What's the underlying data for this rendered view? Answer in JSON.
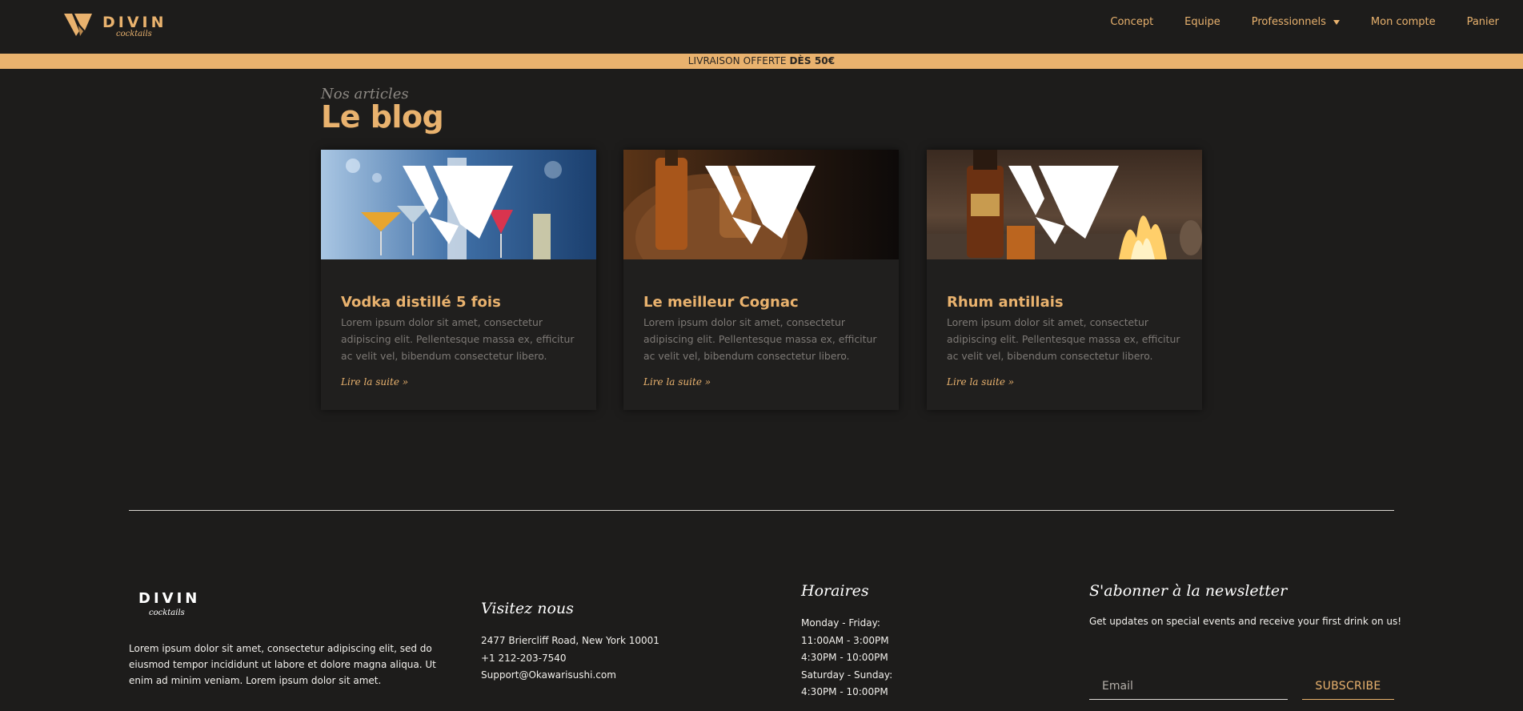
{
  "header": {
    "logo_text": "DIVIN",
    "logo_script": "cocktails",
    "nav": [
      "Concept",
      "Equipe",
      "Professionnels",
      "Mon compte",
      "Panier"
    ]
  },
  "promo": {
    "text": "LIVRAISON OFFERTE ",
    "bold": "DÈS 50€"
  },
  "blog": {
    "subtitle": "Nos articles",
    "title": "Le blog",
    "posts": [
      {
        "title": "Vodka distillé 5 fois",
        "excerpt": "Lorem ipsum dolor sit amet, consectetur adipiscing elit. Pellentesque massa ex, efficitur ac velit vel, bibendum consectetur libero.",
        "link": "Lire la suite »",
        "image": "vodka-cocktails-image"
      },
      {
        "title": "Le meilleur Cognac",
        "excerpt": "Lorem ipsum dolor sit amet, consectetur adipiscing elit. Pellentesque massa ex, efficitur ac velit vel, bibendum consectetur libero.",
        "link": "Lire la suite »",
        "image": "cognac-barrel-image"
      },
      {
        "title": "Rhum antillais",
        "excerpt": "Lorem ipsum dolor sit amet, consectetur adipiscing elit. Pellentesque massa ex, efficitur ac velit vel, bibendum consectetur libero.",
        "link": "Lire la suite »",
        "image": "rum-fire-image"
      }
    ]
  },
  "footer": {
    "logo_text": "DIVIN",
    "logo_script": "cocktails",
    "about": "Lorem ipsum dolor sit amet, consectetur adipiscing elit, sed do eiusmod tempor incididunt ut labore et dolore magna aliqua. Ut enim ad minim veniam. Lorem ipsum dolor sit amet.",
    "visit": {
      "heading": "Visitez nous",
      "lines": [
        "2477 Briercliff Road, New York 10001",
        "+1 212-203-7540",
        "Support@Okawarisushi.com"
      ]
    },
    "hours": {
      "heading": "Horaires",
      "lines": [
        "Monday - Friday:",
        "11:00AM - 3:00PM",
        "4:30PM - 10:00PM",
        "Saturday - Sunday:",
        "4:30PM - 10:00PM"
      ]
    },
    "newsletter": {
      "heading": "S'abonner à la newsletter",
      "text": "Get updates on special events and receive your first drink on us!",
      "placeholder": "Email",
      "button": "SUBSCRIBE"
    }
  },
  "colors": {
    "background": "#1d1c1b",
    "accent": "#e9b26e",
    "card": "#201f1e",
    "muted_text": "#7d7975"
  }
}
